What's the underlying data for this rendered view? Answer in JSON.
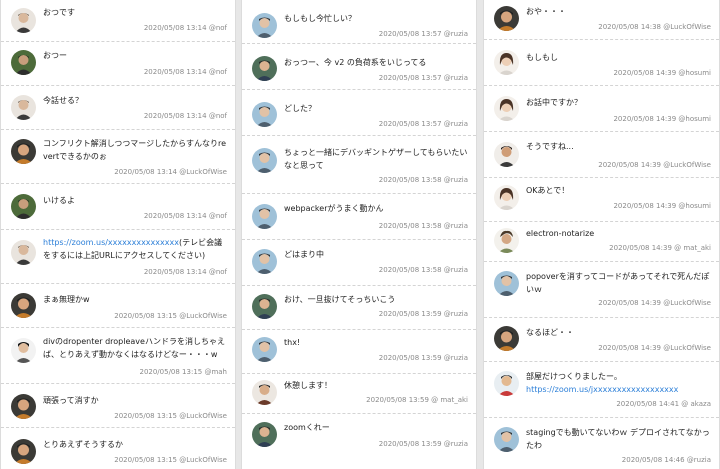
{
  "columns": [
    {
      "messages": [
        {
          "avatar": "avatar-nof",
          "text": "おつです",
          "meta": "2020/05/08 13:14 @nof"
        },
        {
          "avatar": "avatar-nof-2",
          "text": "おつー",
          "meta": "2020/05/08 13:14 @nof"
        },
        {
          "avatar": "avatar-nof",
          "text": "今話せる？",
          "meta": "2020/05/08 13:14 @nof"
        },
        {
          "avatar": "avatar-luckofwise",
          "text": "コンフリクト解消しつつマージしたからすんなりrevertできるかのぉ",
          "meta": "2020/05/08 13:14 @LuckOfWise"
        },
        {
          "avatar": "avatar-nof-2",
          "text": "いけるよ",
          "meta": "2020/05/08 13:14 @nof"
        },
        {
          "avatar": "avatar-nof",
          "link": "https://zoom.us/xxxxxxxxxxxxxxx",
          "text": "(テレビ会議をするには上記URLにアクセスしてください)",
          "meta": "2020/05/08 13:14 @nof"
        },
        {
          "avatar": "avatar-luckofwise",
          "text": "まぁ無理かw",
          "meta": "2020/05/08 13:15 @LuckOfWise"
        },
        {
          "avatar": "avatar-mah",
          "text": "divのdropenter dropleaveハンドラを消しちゃえば、とりあえず動かなくはなるけどなー・・・w",
          "meta": "2020/05/08 13:15 @mah"
        },
        {
          "avatar": "avatar-luckofwise",
          "text": "頑張って消すか",
          "meta": "2020/05/08 13:15 @LuckOfWise"
        },
        {
          "avatar": "avatar-luckofwise",
          "text": "とりあえずそうするか",
          "meta": "2020/05/08 13:15 @LuckOfWise"
        }
      ]
    },
    {
      "messages": [
        {
          "avatar": "avatar-ruzia",
          "text": "もしもし今忙しい？",
          "meta": "2020/05/08 13:57 @ruzia"
        },
        {
          "avatar": "avatar-ruzia-2",
          "text": "おっつー、今 v2 の負荷系をいじってる",
          "meta": "2020/05/08 13:57 @ruzia"
        },
        {
          "avatar": "avatar-ruzia",
          "text": "どした？",
          "meta": "2020/05/08 13:57 @ruzia"
        },
        {
          "avatar": "avatar-ruzia",
          "text": "ちょっと一緒にデバッギントゲザーしてもらいたいなと思って",
          "meta": "2020/05/08 13:58 @ruzia"
        },
        {
          "avatar": "avatar-ruzia",
          "text": "webpackerがうまく動かん",
          "meta": "2020/05/08 13:58 @ruzia"
        },
        {
          "avatar": "avatar-ruzia",
          "text": "どはまり中",
          "meta": "2020/05/08 13:58 @ruzia"
        },
        {
          "avatar": "avatar-ruzia-2",
          "text": "おけ、一旦抜けてそっちいこう",
          "meta": "2020/05/08 13:59 @ruzia"
        },
        {
          "avatar": "avatar-ruzia",
          "text": "thx!",
          "meta": "2020/05/08 13:59 @ruzia"
        },
        {
          "avatar": "avatar-mat-aki",
          "text": "休憩します！",
          "meta": "2020/05/08 13:59 @ mat_aki"
        },
        {
          "avatar": "avatar-ruzia-2",
          "text": "zoomくれー",
          "meta": "2020/05/08 13:59 @ruzia"
        }
      ]
    },
    {
      "messages": [
        {
          "avatar": "avatar-luckofwise",
          "text": "おや・・・",
          "meta": "2020/05/08 14:38 @LuckOfWise"
        },
        {
          "avatar": "avatar-hosumi",
          "text": "もしもし",
          "meta": "2020/05/08 14:39 @hosumi"
        },
        {
          "avatar": "avatar-hosumi",
          "text": "お話中ですか？",
          "meta": "2020/05/08 14:39 @hosumi"
        },
        {
          "avatar": "avatar-luckofwise-2",
          "text": "そうですね...",
          "meta": "2020/05/08 14:39 @LuckOfWise"
        },
        {
          "avatar": "avatar-hosumi",
          "text": "OKあとで！",
          "meta": "2020/05/08 14:39 @hosumi"
        },
        {
          "avatar": "avatar-mat-aki-2",
          "text": "electron-notarize",
          "meta": "2020/05/08 14:39 @ mat_aki"
        },
        {
          "avatar": "avatar-ruzia",
          "text": "popoverを消すってコードがあってそれで死んだぽいｗ",
          "meta": "2020/05/08 14:39 @LuckOfWise"
        },
        {
          "avatar": "avatar-luckofwise",
          "text": "なるほど・・",
          "meta": "2020/05/08 14:39 @LuckOfWise"
        },
        {
          "avatar": "avatar-akaza",
          "text": "部屋だけつくりましたー。",
          "link2": "https://zoom.us/jxxxxxxxxxxxxxxxxxx",
          "meta": "2020/05/08 14:41 @ akaza"
        },
        {
          "avatar": "avatar-ruzia",
          "text": "stagingでも動いてないわｗ デプロイされてなかったわ",
          "meta": "2020/05/08 14:46 @ruzia"
        }
      ]
    }
  ]
}
